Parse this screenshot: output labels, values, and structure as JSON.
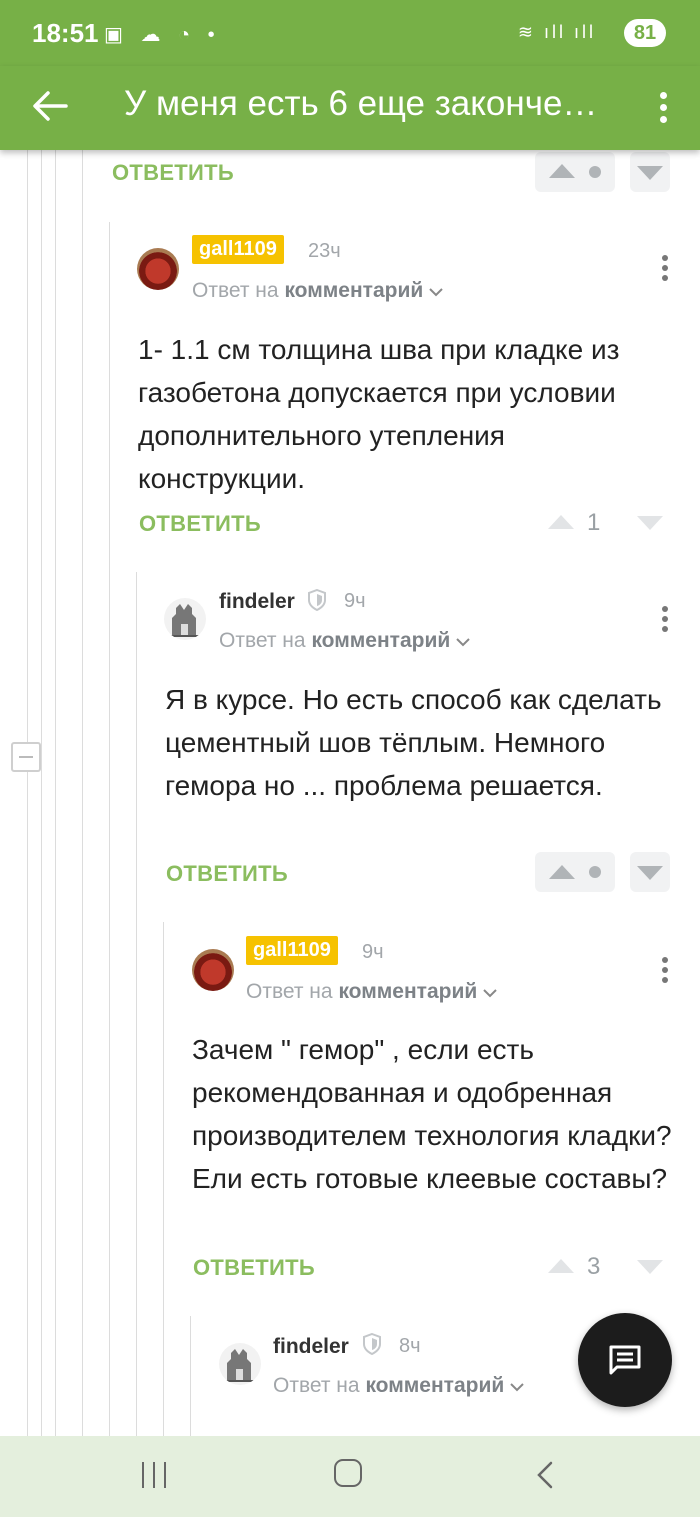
{
  "status_bar": {
    "time": "18:51",
    "icons_left": "▣ ☁ ◔ •",
    "icons_right": "≋ ıll ıll",
    "battery": "81"
  },
  "app_bar": {
    "title": "У меня есть 6 еще законче…"
  },
  "colors": {
    "accent": "#77b047",
    "reply_link": "#8bbd5f",
    "badge": "#f6c200"
  },
  "reply_label": "ОТВЕТИТЬ",
  "comments": [
    {
      "reply_label": "ОТВЕТИТЬ"
    },
    {
      "username": "gall1109",
      "time": "23ч",
      "reply_prefix": "Ответ на",
      "reply_target": "комментарий",
      "text": "1- 1.1 см толщина шва при кладке из газобетона допускается при условии дополнительного утепления конструкции.",
      "reply_label": "ОТВЕТИТЬ",
      "rating": "1"
    },
    {
      "username": "findeler",
      "time": "9ч",
      "reply_prefix": "Ответ на",
      "reply_target": "комментарий",
      "text": "Я в курсе. Но есть способ как сделать цементный шов тёплым. Немного гемора но ... проблема решается.",
      "reply_label": "ОТВЕТИТЬ"
    },
    {
      "username": "gall1109",
      "time": "9ч",
      "reply_prefix": "Ответ на",
      "reply_target": "комментарий",
      "text": "Зачем \" гемор\" , если есть рекомендованная и одобренная производителем технология кладки? Ели есть готовые клеевые составы?",
      "reply_label": "ОТВЕТИТЬ",
      "rating": "3"
    },
    {
      "username": "findeler",
      "time": "8ч",
      "reply_prefix": "Ответ на",
      "reply_target": "комментарий"
    }
  ],
  "icons": {
    "back": "arrow-left-icon",
    "menu": "more-vert-icon",
    "fab": "chat-icon",
    "upvote": "triangle-up-icon",
    "downvote": "triangle-down-icon",
    "collapse": "minus-box-icon",
    "shield": "shield-icon"
  }
}
